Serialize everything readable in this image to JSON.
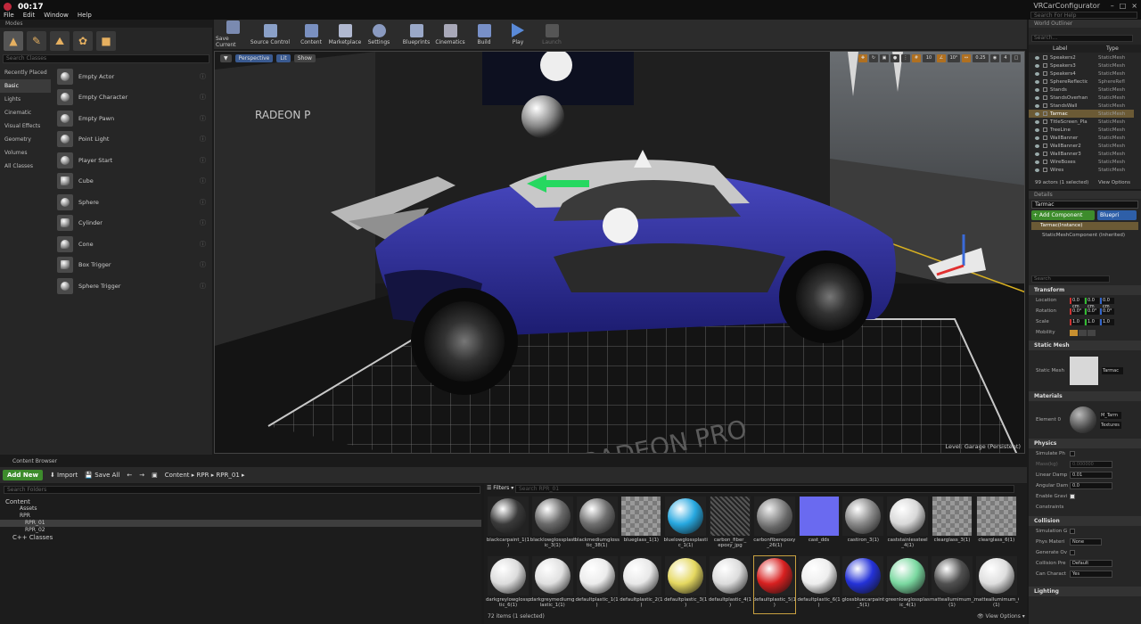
{
  "top": {
    "clock": "00:17",
    "menu": [
      "File",
      "Edit",
      "Window",
      "Help"
    ],
    "app_name": "VRCarConfigurator",
    "help_placeholder": "Search For Help",
    "window_buttons": [
      "–",
      "□",
      "×"
    ]
  },
  "modes": {
    "tab": "Modes",
    "search_placeholder": "Search Classes",
    "categories": [
      "Recently Placed",
      "Basic",
      "Lights",
      "Cinematic",
      "Visual Effects",
      "Geometry",
      "Volumes",
      "All Classes"
    ],
    "items": [
      "Empty Actor",
      "Empty Character",
      "Empty Pawn",
      "Point Light",
      "Player Start",
      "Cube",
      "Sphere",
      "Cylinder",
      "Cone",
      "Box Trigger",
      "Sphere Trigger"
    ]
  },
  "toolbar": {
    "buttons": [
      "Save Current",
      "Source Control",
      "Content",
      "Marketplace",
      "Settings",
      "Blueprints",
      "Cinematics",
      "Build",
      "Play",
      "Launch"
    ]
  },
  "viewport": {
    "perspective": "Perspective",
    "lit": "Lit",
    "show": "Show",
    "grid_snap": "10",
    "rot_snap": "10°",
    "scale_snap": "0.25",
    "cam_speed": "4",
    "level_label": "Level:  Garage (Persistent)",
    "banner_texts": [
      "RADEON P",
      "RADEON PRO"
    ]
  },
  "outliner": {
    "tab": "World Outliner",
    "search_placeholder": "Search...",
    "col_label": "Label",
    "col_type": "Type",
    "rows": [
      {
        "label": "Speakers2",
        "type": "StaticMesh"
      },
      {
        "label": "Speakers3",
        "type": "StaticMesh"
      },
      {
        "label": "Speakers4",
        "type": "StaticMesh"
      },
      {
        "label": "SphereReflectio",
        "type": "SphereRefl"
      },
      {
        "label": "Stands",
        "type": "StaticMesh"
      },
      {
        "label": "StandsOverhan",
        "type": "StaticMesh"
      },
      {
        "label": "StandsWall",
        "type": "StaticMesh"
      },
      {
        "label": "Tarmac",
        "type": "StaticMesh"
      },
      {
        "label": "TitleScreen_Pla",
        "type": "StaticMesh"
      },
      {
        "label": "TreeLine",
        "type": "StaticMesh"
      },
      {
        "label": "WallBanner",
        "type": "StaticMesh"
      },
      {
        "label": "WallBanner2",
        "type": "StaticMesh"
      },
      {
        "label": "WallBanner3",
        "type": "StaticMesh"
      },
      {
        "label": "WireBoxes",
        "type": "StaticMesh"
      },
      {
        "label": "Wires",
        "type": "StaticMesh"
      }
    ],
    "selected_index": 7,
    "footer": "99 actors (1 selected)",
    "view_options": "View Options"
  },
  "details": {
    "tab": "Details",
    "name": "Tarmac",
    "add_component": "+ Add Component",
    "blueprint": "Bluepri",
    "instance": "Tarmac(Instance)",
    "component": "StaticMeshComponent (Inherited)",
    "search_placeholder": "Search",
    "transform": "Transform",
    "location": "Location",
    "rotation": "Rotation",
    "scale": "Scale",
    "mobility": "Mobility",
    "loc_vals": [
      "0.0 cm",
      "0.0 cm",
      "0.0 cm"
    ],
    "rot_vals": [
      "0.0°",
      "0.0°",
      "0.0°"
    ],
    "scale_vals": [
      "1.0",
      "1.0",
      "1.0"
    ],
    "static_mesh_hdr": "Static Mesh",
    "static_mesh_lbl": "Static Mesh",
    "static_mesh_val": "Tarmac",
    "materials_hdr": "Materials",
    "element0": "Element 0",
    "material_val": "M_Tarm",
    "textures": "Textures",
    "physics_hdr": "Physics",
    "sim_physics": "Simulate Ph",
    "mass": "Mass(kg)",
    "mass_val": "0.000000",
    "linear_damping": "Linear Damp",
    "linear_val": "0.01",
    "angular_damping": "Angular Dam",
    "angular_val": "0.0",
    "enable_gravity": "Enable Gravi",
    "constraints": "Constraints",
    "collision_hdr": "Collision",
    "sim_gen": "Simulation G",
    "phys_mat": "Phys Materi",
    "phys_mat_val": "None",
    "gen_overlap": "Generate Ov",
    "coll_presets": "Collision Pre",
    "coll_presets_val": "Default",
    "can_char": "Can Charact",
    "can_char_val": "Yes",
    "lighting_hdr": "Lighting"
  },
  "content_browser": {
    "tab": "Content Browser",
    "add_new": "Add New",
    "import": "Import",
    "save_all": "Save All",
    "path": [
      "Content",
      "RPR",
      "RPR_01"
    ],
    "folder_search": "Search Folders",
    "folders": [
      "Content",
      "Assets",
      "RPR",
      "RPR_01",
      "RPR_02",
      "C++ Classes"
    ],
    "filters": "Filters",
    "asset_search": "Search RPR_01",
    "assets": [
      {
        "name": "blackcarpaint_1(1\n)",
        "color": "#3a3a3a"
      },
      {
        "name": "blacklowglossplast\nic_3(1)",
        "color": "#6a6a6a"
      },
      {
        "name": "blackmediumglossplas\ntic_38(1)",
        "color": "#6f6f6f"
      },
      {
        "name": "blueglass_1(1)",
        "color": "checker"
      },
      {
        "name": "bluelowglossplasti\nc_1(1)",
        "color": "#27a8e0"
      },
      {
        "name": "carbon_fiber_\nepoxy_jpg",
        "color": "carbon"
      },
      {
        "name": "carbonfiberepoxy\n_26(1)",
        "color": "carbonball"
      },
      {
        "name": "cast_dds",
        "color": "#6a6af0"
      },
      {
        "name": "castiron_3(1)",
        "color": "#888888"
      },
      {
        "name": "caststainlessteel\n_4(1)",
        "color": "#d8d8d8"
      },
      {
        "name": "clearglass_3(1)",
        "color": "checker"
      },
      {
        "name": "clearglass_6(1)",
        "color": "checker"
      },
      {
        "name": "darkgreylowglossplas\ntic_6(1)",
        "color": "#dcdcdc"
      },
      {
        "name": "darkgreymediumglossp\nlastic_1(1)",
        "color": "#e0e0e0"
      },
      {
        "name": "defaultplastic_1(1\n)",
        "color": "#ececec"
      },
      {
        "name": "defaultplastic_2(1\n)",
        "color": "#e8e8e8"
      },
      {
        "name": "defaultplastic_3(1\n)",
        "color": "#e5d860"
      },
      {
        "name": "defaultplastic_4(1\n)",
        "color": "#dcdcdc"
      },
      {
        "name": "defaultplastic_5(1\n)",
        "color": "#d82020"
      },
      {
        "name": "defaultplastic_6(1\n)",
        "color": "#eeeeee"
      },
      {
        "name": "glossbluecarpaint\n_5(1)",
        "color": "#2432d8"
      },
      {
        "name": "greenlowglossplast\nic_4(1)",
        "color": "#7ad8a0"
      },
      {
        "name": "matteallumimum_2\n(1)",
        "color": "#505050"
      },
      {
        "name": "matteallumimum_6\n(1)",
        "color": "#dedede"
      }
    ],
    "count": "72 items (1 selected)",
    "view_options": "View Options"
  },
  "colors": {
    "accent": "#e6b060",
    "add_green": "#3d8c2c",
    "car_blue": "#2a2a9a",
    "selection": "#6b5a35"
  }
}
